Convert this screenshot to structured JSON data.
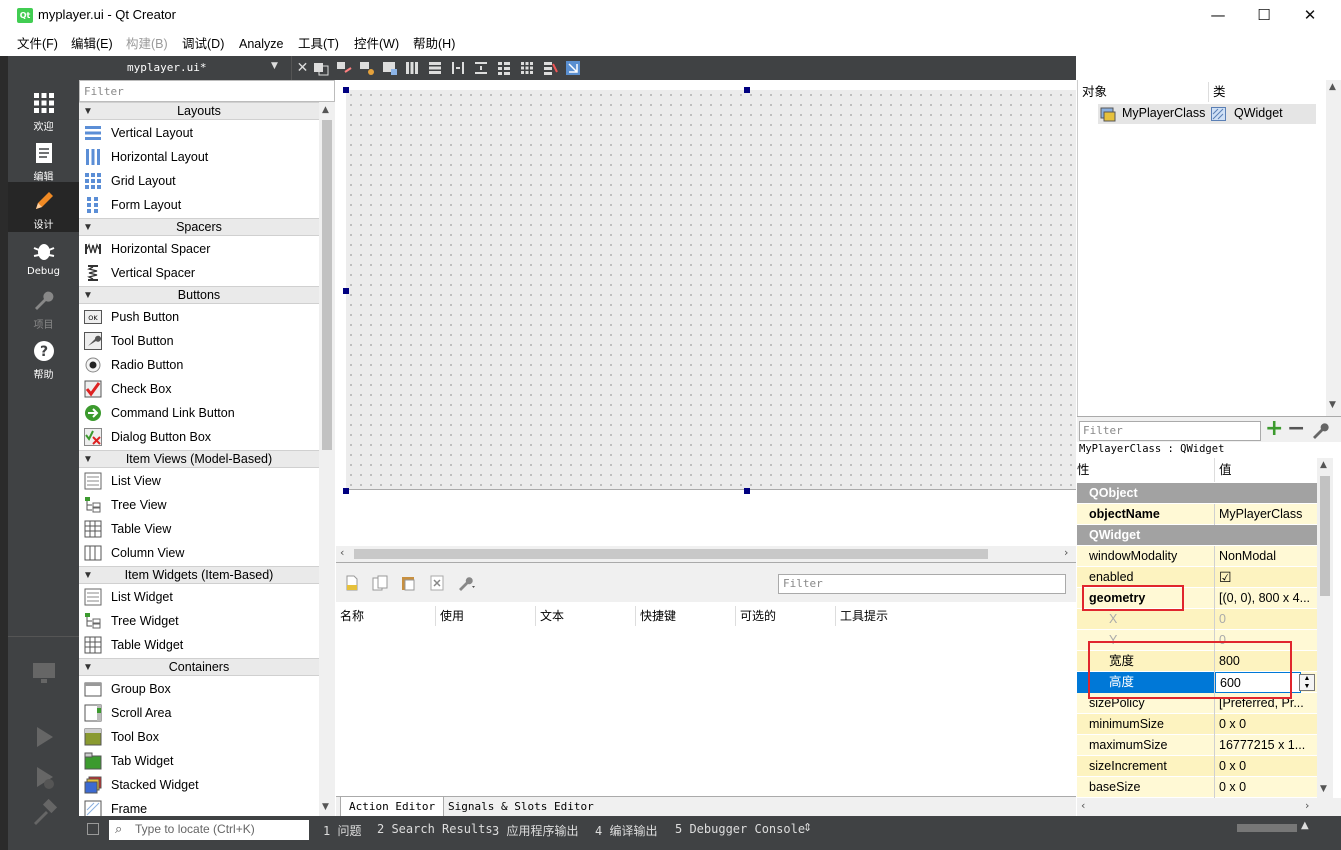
{
  "window": {
    "title": "myplayer.ui - Qt Creator",
    "app_icon": "Qt",
    "controls": {
      "minimize": "—",
      "maximize": "☐",
      "close": "✕"
    }
  },
  "menu": {
    "items": [
      {
        "label": "文件(F)",
        "disabled": false
      },
      {
        "label": "编辑(E)",
        "disabled": false
      },
      {
        "label": "构建(B)",
        "disabled": true
      },
      {
        "label": "调试(D)",
        "disabled": false
      },
      {
        "label": "Analyze",
        "disabled": false
      },
      {
        "label": "工具(T)",
        "disabled": false
      },
      {
        "label": "控件(W)",
        "disabled": false
      },
      {
        "label": "帮助(H)",
        "disabled": false
      }
    ]
  },
  "modes": [
    {
      "label": "欢迎",
      "icon": "grid-icon"
    },
    {
      "label": "编辑",
      "icon": "document-icon"
    },
    {
      "label": "设计",
      "icon": "pencil-icon"
    },
    {
      "label": "Debug",
      "icon": "bug-icon"
    },
    {
      "label": "项目",
      "icon": "wrench-icon"
    },
    {
      "label": "帮助",
      "icon": "help-icon"
    }
  ],
  "widgetbox": {
    "file_tab": "myplayer.ui*",
    "close": "✕",
    "filter_placeholder": "Filter",
    "categories": [
      {
        "name": "Layouts",
        "items": [
          "Vertical Layout",
          "Horizontal Layout",
          "Grid Layout",
          "Form Layout"
        ]
      },
      {
        "name": "Spacers",
        "items": [
          "Horizontal Spacer",
          "Vertical Spacer"
        ]
      },
      {
        "name": "Buttons",
        "items": [
          "Push Button",
          "Tool Button",
          "Radio Button",
          "Check Box",
          "Command Link Button",
          "Dialog Button Box"
        ]
      },
      {
        "name": "Item Views (Model-Based)",
        "items": [
          "List View",
          "Tree View",
          "Table View",
          "Column View"
        ]
      },
      {
        "name": "Item Widgets (Item-Based)",
        "items": [
          "List Widget",
          "Tree Widget",
          "Table Widget"
        ]
      },
      {
        "name": "Containers",
        "items": [
          "Group Box",
          "Scroll Area",
          "Tool Box",
          "Tab Widget",
          "Stacked Widget",
          "Frame"
        ]
      }
    ]
  },
  "action_editor": {
    "filter_placeholder": "Filter",
    "columns": [
      "名称",
      "使用",
      "文本",
      "快捷键",
      "可选的",
      "工具提示"
    ],
    "tabs": [
      "Action Editor",
      "Signals & Slots Editor"
    ]
  },
  "object_inspector": {
    "columns": [
      "对象",
      "类"
    ],
    "object_name": "MyPlayerClass",
    "object_class": "QWidget"
  },
  "property_editor": {
    "filter_placeholder": "Filter",
    "class_line": "MyPlayerClass : QWidget",
    "headers": [
      "性",
      "值"
    ],
    "rows": [
      {
        "name": "QObject",
        "value": "",
        "kind": "group"
      },
      {
        "name": "objectName",
        "value": "MyPlayerClass",
        "kind": "bold-yellow"
      },
      {
        "name": "QWidget",
        "value": "",
        "kind": "group"
      },
      {
        "name": "windowModality",
        "value": "NonModal",
        "kind": "yellow"
      },
      {
        "name": "enabled",
        "value": "☑",
        "kind": "yellow2"
      },
      {
        "name": "geometry",
        "value": "[(0, 0), 800 x 4...",
        "kind": "bold-yellow"
      },
      {
        "name": "X",
        "value": "0",
        "kind": "sub-dim"
      },
      {
        "name": "Y",
        "value": "0",
        "kind": "sub-dim"
      },
      {
        "name": "宽度",
        "value": "800",
        "kind": "sub"
      },
      {
        "name": "高度",
        "value": "600",
        "kind": "sub-selected"
      },
      {
        "name": "sizePolicy",
        "value": "[Preferred, Pr...",
        "kind": "yellow"
      },
      {
        "name": "minimumSize",
        "value": "0 x 0",
        "kind": "yellow2"
      },
      {
        "name": "maximumSize",
        "value": "16777215 x 1...",
        "kind": "yellow"
      },
      {
        "name": "sizeIncrement",
        "value": "0 x 0",
        "kind": "yellow2"
      },
      {
        "name": "baseSize",
        "value": "0 x 0",
        "kind": "yellow"
      }
    ]
  },
  "statusbar": {
    "locator_placeholder": "Type to locate (Ctrl+K)",
    "panes": [
      "1 问题",
      "2 Search Results",
      "3 应用程序输出",
      "4 编译输出",
      "5 Debugger Console"
    ]
  },
  "colors": {
    "accent": "#0078d7",
    "sidebar": "#404244",
    "highlight": "#e0262d",
    "property_yellow": "#fff9d5"
  }
}
